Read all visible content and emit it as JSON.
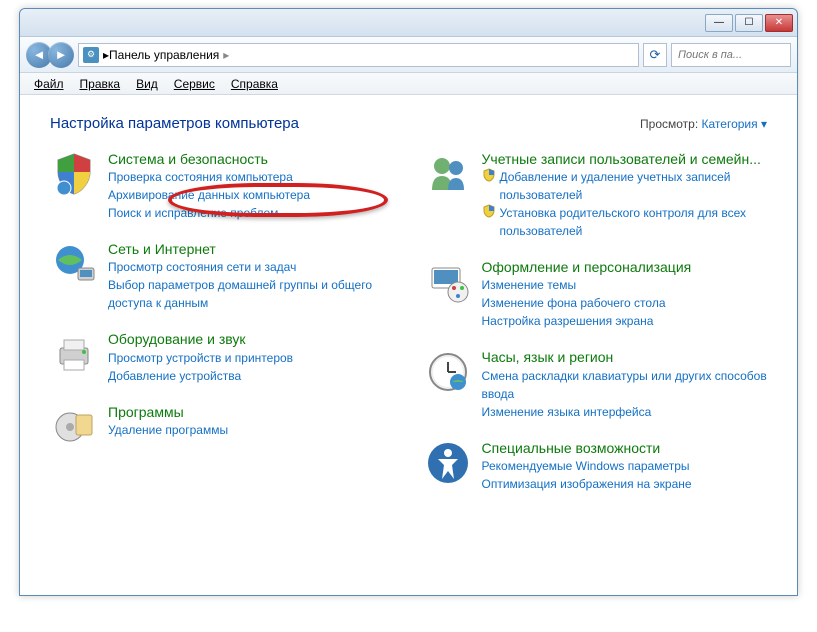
{
  "titlebar": {
    "min": "—",
    "max": "☐",
    "close": "✕"
  },
  "nav": {
    "breadcrumb_label": "Панель управления",
    "breadcrumb_sep": "▸",
    "refresh": "⟳",
    "search_placeholder": "Поиск в па..."
  },
  "menu": {
    "file": "Файл",
    "edit": "Правка",
    "view": "Вид",
    "tools": "Сервис",
    "help": "Справка"
  },
  "content": {
    "title": "Настройка параметров компьютера",
    "view_label": "Просмотр:",
    "view_value": "Категория ▾"
  },
  "left": [
    {
      "title": "Система и безопасность",
      "links": [
        "Проверка состояния компьютера",
        "Архивирование данных компьютера",
        "Поиск и исправление проблем"
      ]
    },
    {
      "title": "Сеть и Интернет",
      "links": [
        "Просмотр состояния сети и задач",
        "Выбор параметров домашней группы и общего доступа к данным"
      ]
    },
    {
      "title": "Оборудование и звук",
      "links": [
        "Просмотр устройств и принтеров",
        "Добавление устройства"
      ]
    },
    {
      "title": "Программы",
      "links": [
        "Удаление программы"
      ]
    }
  ],
  "right": [
    {
      "title": "Учетные записи пользователей и семейн...",
      "links": [
        "Добавление и удаление учетных записей пользователей",
        "Установка родительского контроля для всех пользователей"
      ],
      "shielded": [
        true,
        true
      ]
    },
    {
      "title": "Оформление и персонализация",
      "links": [
        "Изменение темы",
        "Изменение фона рабочего стола",
        "Настройка разрешения экрана"
      ]
    },
    {
      "title": "Часы, язык и регион",
      "links": [
        "Смена раскладки клавиатуры или других способов ввода",
        "Изменение языка интерфейса"
      ]
    },
    {
      "title": "Специальные возможности",
      "links": [
        "Рекомендуемые Windows параметры",
        "Оптимизация изображения на экране"
      ]
    }
  ]
}
